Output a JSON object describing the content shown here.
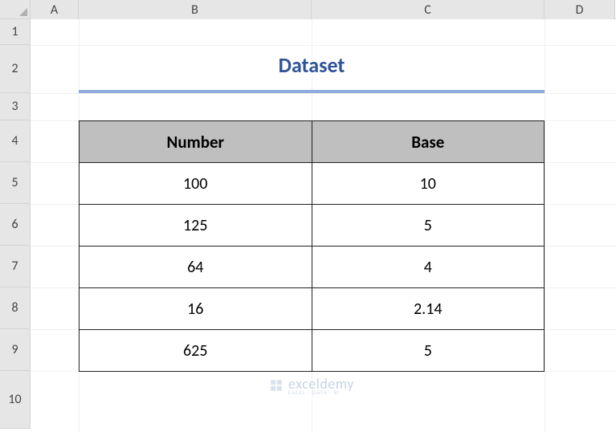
{
  "columns": [
    "A",
    "B",
    "C",
    "D"
  ],
  "rows": [
    "1",
    "2",
    "3",
    "4",
    "5",
    "6",
    "7",
    "8",
    "9",
    "10"
  ],
  "title": "Dataset",
  "table": {
    "headers": {
      "col_b": "Number",
      "col_c": "Base"
    },
    "data": [
      {
        "number": "100",
        "base": "10"
      },
      {
        "number": "125",
        "base": "5"
      },
      {
        "number": "64",
        "base": "4"
      },
      {
        "number": "16",
        "base": "2.14"
      },
      {
        "number": "625",
        "base": "5"
      }
    ]
  },
  "watermark": {
    "text": "exceldemy",
    "sub": "EXCEL · DATA · BI"
  },
  "chart_data": {
    "type": "table",
    "title": "Dataset",
    "columns": [
      "Number",
      "Base"
    ],
    "rows": [
      [
        100,
        10
      ],
      [
        125,
        5
      ],
      [
        64,
        4
      ],
      [
        16,
        2.14
      ],
      [
        625,
        5
      ]
    ]
  }
}
